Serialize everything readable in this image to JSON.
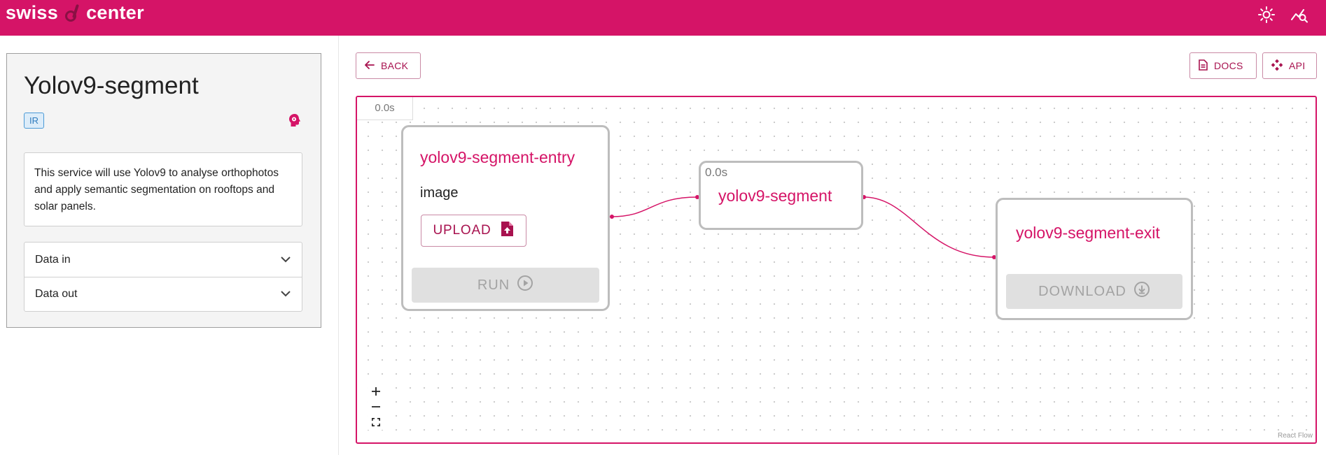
{
  "header": {
    "brand_left": "swiss",
    "brand_right": "center",
    "accent_color": "#d51467",
    "icons": [
      "sun-icon",
      "analytics-search-icon"
    ]
  },
  "sidebar": {
    "title": "Yolov9-segment",
    "badge": "IR",
    "description": "This service will use Yolov9 to analyse orthophotos and apply semantic segmentation on rooftops and solar panels.",
    "accordion": [
      {
        "label": "Data in"
      },
      {
        "label": "Data out"
      }
    ]
  },
  "toolbar": {
    "back_label": "BACK",
    "docs_label": "DOCS",
    "api_label": "API"
  },
  "flow": {
    "global_timer": "0.0s",
    "entry_node": {
      "title": "yolov9-segment-entry",
      "input_label": "image",
      "upload_label": "UPLOAD",
      "run_label": "RUN"
    },
    "service_node": {
      "timer": "0.0s",
      "title": "yolov9-segment"
    },
    "exit_node": {
      "title": "yolov9-segment-exit",
      "download_label": "DOWNLOAD"
    },
    "attribution": "React Flow"
  }
}
